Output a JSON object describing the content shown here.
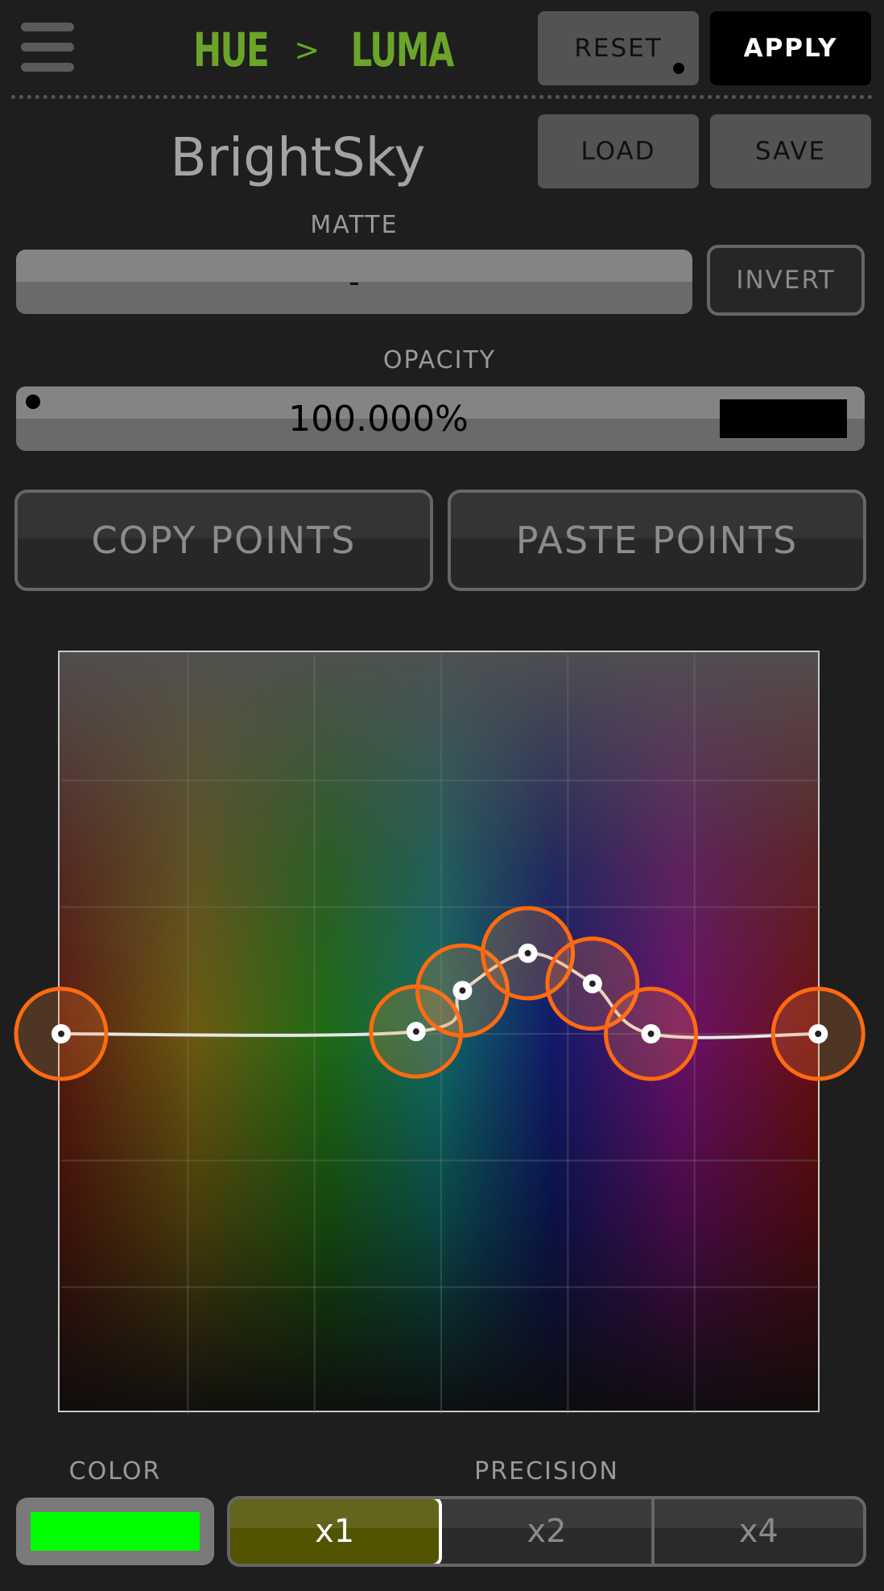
{
  "header": {
    "title_left": "HUE",
    "title_arrow": ">",
    "title_right": "LUMA",
    "title_color": "#6aa52a",
    "menu_icon": "hamburger-menu-icon",
    "reset_label": "RESET",
    "apply_label": "APPLY"
  },
  "preset": {
    "name": "BrightSky",
    "load_label": "LOAD",
    "save_label": "SAVE"
  },
  "matte": {
    "label": "MATTE",
    "value": "-",
    "invert_label": "INVERT"
  },
  "opacity": {
    "label": "OPACITY",
    "value": "100.000%"
  },
  "points": {
    "copy_label": "COPY POINTS",
    "paste_label": "PASTE POINTS"
  },
  "curve": {
    "type": "hue-vs-luma curve",
    "grid": true,
    "points": [
      {
        "hue": 0.0,
        "luma": 0.5
      },
      {
        "hue": 0.467,
        "luma": 0.503
      },
      {
        "hue": 0.528,
        "luma": 0.557
      },
      {
        "hue": 0.614,
        "luma": 0.606
      },
      {
        "hue": 0.699,
        "luma": 0.566
      },
      {
        "hue": 0.776,
        "luma": 0.5
      },
      {
        "hue": 0.996,
        "luma": 0.5
      }
    ],
    "point_ring_color": "#ff6a10",
    "line_color": "#e6e6e6"
  },
  "color": {
    "label": "COLOR",
    "swatch": "#00ff00"
  },
  "precision": {
    "label": "PRECISION",
    "options": [
      "x1",
      "x2",
      "x4"
    ],
    "selected": "x1"
  }
}
